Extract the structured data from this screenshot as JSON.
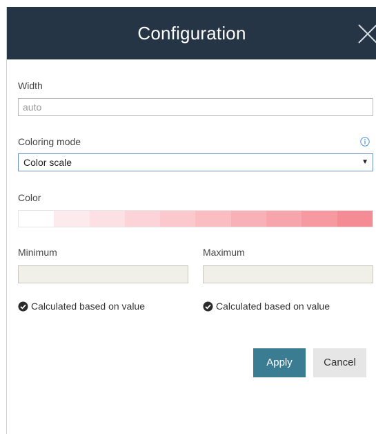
{
  "dialog": {
    "title": "Configuration"
  },
  "width_field": {
    "label": "Width",
    "placeholder": "auto"
  },
  "coloring_mode": {
    "label": "Coloring mode",
    "selected": "Color scale",
    "arrow": "▼"
  },
  "color": {
    "label": "Color",
    "scale": [
      "#ffffff",
      "#fdeaec",
      "#fde0e3",
      "#fcd4d8",
      "#fbc8cd",
      "#fabdc2",
      "#f8b1b7",
      "#f7a5ac",
      "#f699a1",
      "#f48c95"
    ]
  },
  "minimum": {
    "label": "Minimum",
    "value": "",
    "checkbox_label": "Calculated based on value",
    "checked": true
  },
  "maximum": {
    "label": "Maximum",
    "value": "",
    "checkbox_label": "Calculated based on value",
    "checked": true
  },
  "buttons": {
    "apply": "Apply",
    "cancel": "Cancel"
  },
  "colors": {
    "header_bg": "#253545",
    "apply_bg": "#3a7d93",
    "info_icon": "#4a90d9"
  },
  "icons": {
    "close": "close-icon",
    "info": "info-icon",
    "check": "check-circle-icon"
  }
}
